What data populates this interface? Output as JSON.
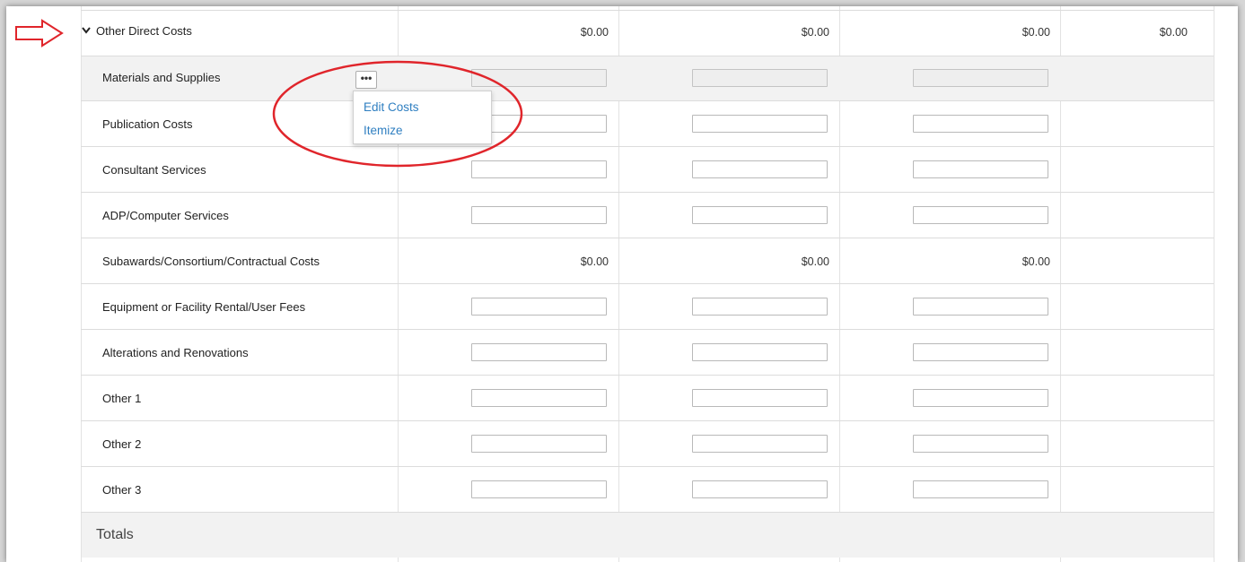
{
  "section": {
    "title": "Other Direct Costs",
    "amounts": [
      "$0.00",
      "$0.00",
      "$0.00",
      "$0.00"
    ]
  },
  "rows": [
    {
      "label": "Materials and Supplies"
    },
    {
      "label": "Publication Costs"
    },
    {
      "label": "Consultant Services"
    },
    {
      "label": "ADP/Computer Services"
    },
    {
      "label": "Subawards/Consortium/Contractual Costs",
      "amounts": [
        "$0.00",
        "$0.00",
        "$0.00"
      ]
    },
    {
      "label": "Equipment or Facility Rental/User Fees"
    },
    {
      "label": "Alterations and Renovations"
    },
    {
      "label": "Other 1"
    },
    {
      "label": "Other 2"
    },
    {
      "label": "Other 3"
    }
  ],
  "more_button": {
    "label": "•••"
  },
  "context_menu": {
    "items": [
      {
        "label": "Edit Costs"
      },
      {
        "label": "Itemize"
      }
    ]
  },
  "totals": {
    "label": "Totals"
  },
  "colors": {
    "annotation_red": "#e0252b",
    "link_blue": "#2f7fc1",
    "shaded_row": "#f2f2f2"
  }
}
